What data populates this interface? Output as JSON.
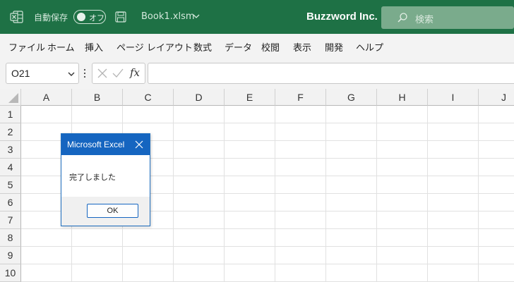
{
  "titlebar": {
    "autosave_label": "自動保存",
    "autosave_state": "オフ",
    "filename": "Book1.xlsm",
    "company": "Buzzword Inc.",
    "search_placeholder": "検索",
    "app_icon": "excel-icon",
    "colors": {
      "background": "#1e7145",
      "search_bg": "#7aab8c"
    }
  },
  "menu": {
    "items": [
      "ファイル",
      "ホーム",
      "挿入",
      "ページ レイアウト",
      "数式",
      "データ",
      "校閲",
      "表示",
      "開発",
      "ヘルプ"
    ]
  },
  "formulabar": {
    "name_box": "O21",
    "fx_label": "fx",
    "formula": ""
  },
  "grid": {
    "columns": [
      "A",
      "B",
      "C",
      "D",
      "E",
      "F",
      "G",
      "H",
      "I",
      "J"
    ],
    "rows": [
      "1",
      "2",
      "3",
      "4",
      "5",
      "6",
      "7",
      "8",
      "9",
      "10"
    ]
  },
  "dialog": {
    "title": "Microsoft Excel",
    "message": "完了しました",
    "ok_label": "OK",
    "colors": {
      "titlebar": "#1565c0"
    }
  }
}
